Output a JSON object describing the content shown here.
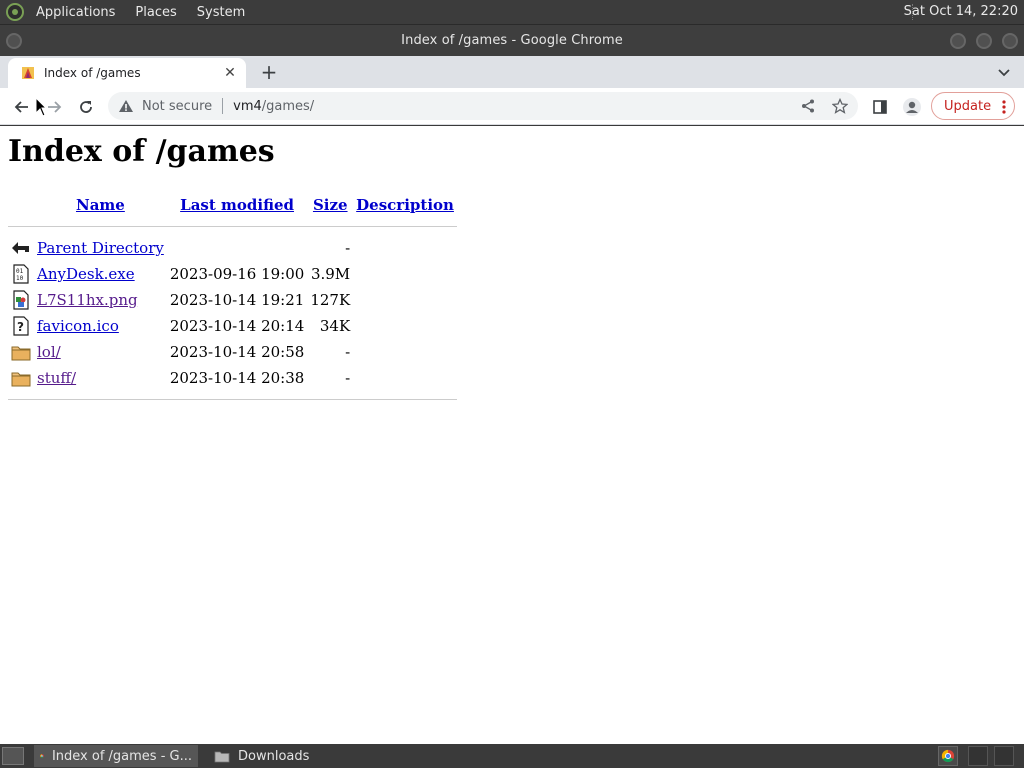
{
  "top_panel": {
    "menus": [
      "Applications",
      "Places",
      "System"
    ],
    "clock": "Sat Oct 14, 22:20"
  },
  "window": {
    "title": "Index of /games - Google Chrome"
  },
  "browser": {
    "tab_title": "Index of /games",
    "new_tab_label": "+",
    "close_label": "✕",
    "security_label": "Not secure",
    "url_host": "vm4",
    "url_path": "/games/",
    "update_label": "Update"
  },
  "page": {
    "heading": "Index of /games",
    "columns": [
      "Name",
      "Last modified",
      "Size",
      "Description"
    ],
    "rows": [
      {
        "icon": "back-arrow-icon",
        "name": "Parent Directory",
        "modified": "",
        "size": "-",
        "description": "",
        "visited": false
      },
      {
        "icon": "binary-icon",
        "name": "AnyDesk.exe",
        "modified": "2023-09-16 19:00",
        "size": "3.9M",
        "description": "",
        "visited": false
      },
      {
        "icon": "image-icon",
        "name": "L7S11hx.png",
        "modified": "2023-10-14 19:21",
        "size": "127K",
        "description": "",
        "visited": true
      },
      {
        "icon": "unknown-file-icon",
        "name": "favicon.ico",
        "modified": "2023-10-14 20:14",
        "size": "34K",
        "description": "",
        "visited": false
      },
      {
        "icon": "folder-icon",
        "name": "lol/",
        "modified": "2023-10-14 20:58",
        "size": "-",
        "description": "",
        "visited": true
      },
      {
        "icon": "folder-icon",
        "name": "stuff/",
        "modified": "2023-10-14 20:38",
        "size": "-",
        "description": "",
        "visited": true
      }
    ]
  },
  "taskbar": {
    "items": [
      {
        "icon": "chrome-icon",
        "label": "Index of /games - G...",
        "active": true
      },
      {
        "icon": "folder-icon",
        "label": "Downloads",
        "active": false
      }
    ]
  },
  "colors": {
    "link": "#0000cc",
    "visited": "#551a8b",
    "panel": "#3c3c3c",
    "tabstrip": "#dee1e6",
    "update": "#c5221f"
  }
}
